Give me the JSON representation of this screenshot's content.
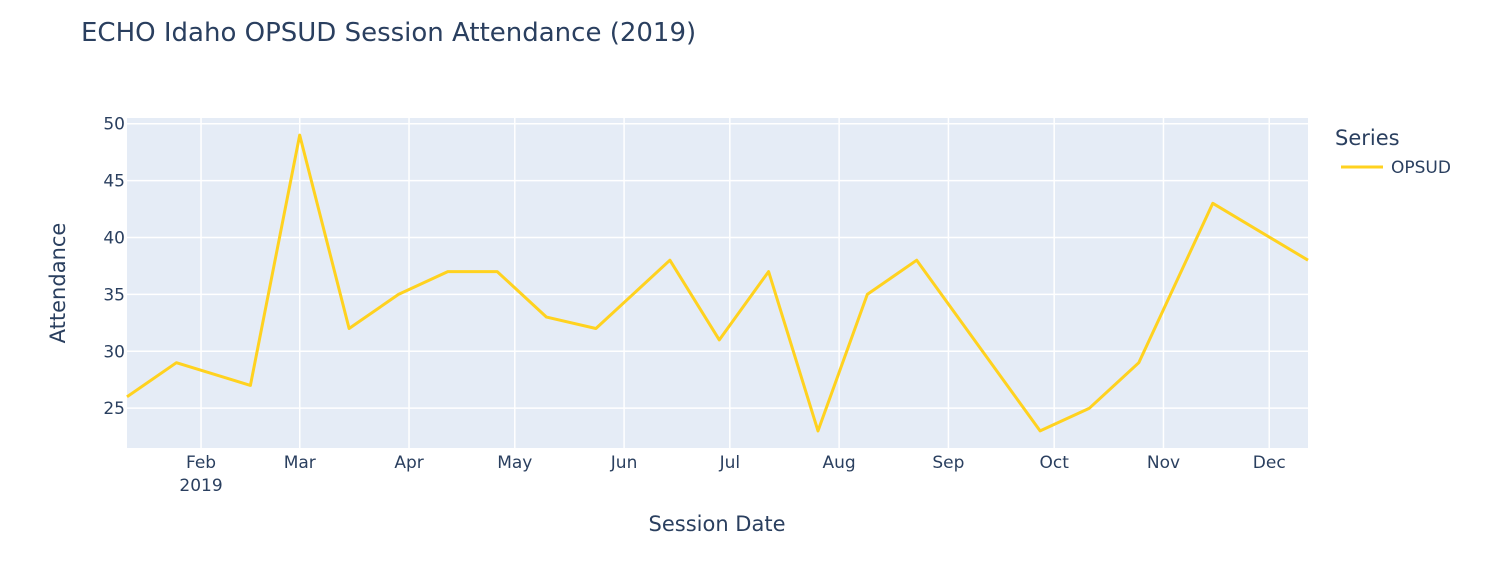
{
  "chart_data": {
    "type": "line",
    "title": "ECHO Idaho OPSUD Session Attendance (2019)",
    "xlabel": "Session Date",
    "ylabel": "Attendance",
    "legend": {
      "title": "Series",
      "position": "top-right"
    },
    "grid": true,
    "xlim": [
      "2019-01-11",
      "2019-12-12"
    ],
    "ylim": [
      21.5,
      50.5
    ],
    "x_ticks": [
      {
        "date": "2019-02-01",
        "label": "Feb",
        "sub": "2019"
      },
      {
        "date": "2019-03-01",
        "label": "Mar"
      },
      {
        "date": "2019-04-01",
        "label": "Apr"
      },
      {
        "date": "2019-05-01",
        "label": "May"
      },
      {
        "date": "2019-06-01",
        "label": "Jun"
      },
      {
        "date": "2019-07-01",
        "label": "Jul"
      },
      {
        "date": "2019-08-01",
        "label": "Aug"
      },
      {
        "date": "2019-09-01",
        "label": "Sep"
      },
      {
        "date": "2019-10-01",
        "label": "Oct"
      },
      {
        "date": "2019-11-01",
        "label": "Nov"
      },
      {
        "date": "2019-12-01",
        "label": "Dec"
      }
    ],
    "y_ticks": [
      25,
      30,
      35,
      40,
      45,
      50
    ],
    "series": [
      {
        "name": "OPSUD",
        "color": "#FFD21F",
        "points": [
          {
            "x": "2019-01-11",
            "y": 26
          },
          {
            "x": "2019-01-25",
            "y": 29
          },
          {
            "x": "2019-02-15",
            "y": 27
          },
          {
            "x": "2019-03-01",
            "y": 49
          },
          {
            "x": "2019-03-15",
            "y": 32
          },
          {
            "x": "2019-03-29",
            "y": 35
          },
          {
            "x": "2019-04-12",
            "y": 37
          },
          {
            "x": "2019-04-26",
            "y": 37
          },
          {
            "x": "2019-05-10",
            "y": 33
          },
          {
            "x": "2019-05-24",
            "y": 32
          },
          {
            "x": "2019-06-14",
            "y": 38
          },
          {
            "x": "2019-06-28",
            "y": 31
          },
          {
            "x": "2019-07-12",
            "y": 37
          },
          {
            "x": "2019-07-26",
            "y": 23
          },
          {
            "x": "2019-08-09",
            "y": 35
          },
          {
            "x": "2019-08-23",
            "y": 38
          },
          {
            "x": "2019-09-27",
            "y": 23
          },
          {
            "x": "2019-10-11",
            "y": 25
          },
          {
            "x": "2019-10-25",
            "y": 29
          },
          {
            "x": "2019-11-15",
            "y": 43
          },
          {
            "x": "2019-12-12",
            "y": 38
          }
        ]
      }
    ]
  }
}
